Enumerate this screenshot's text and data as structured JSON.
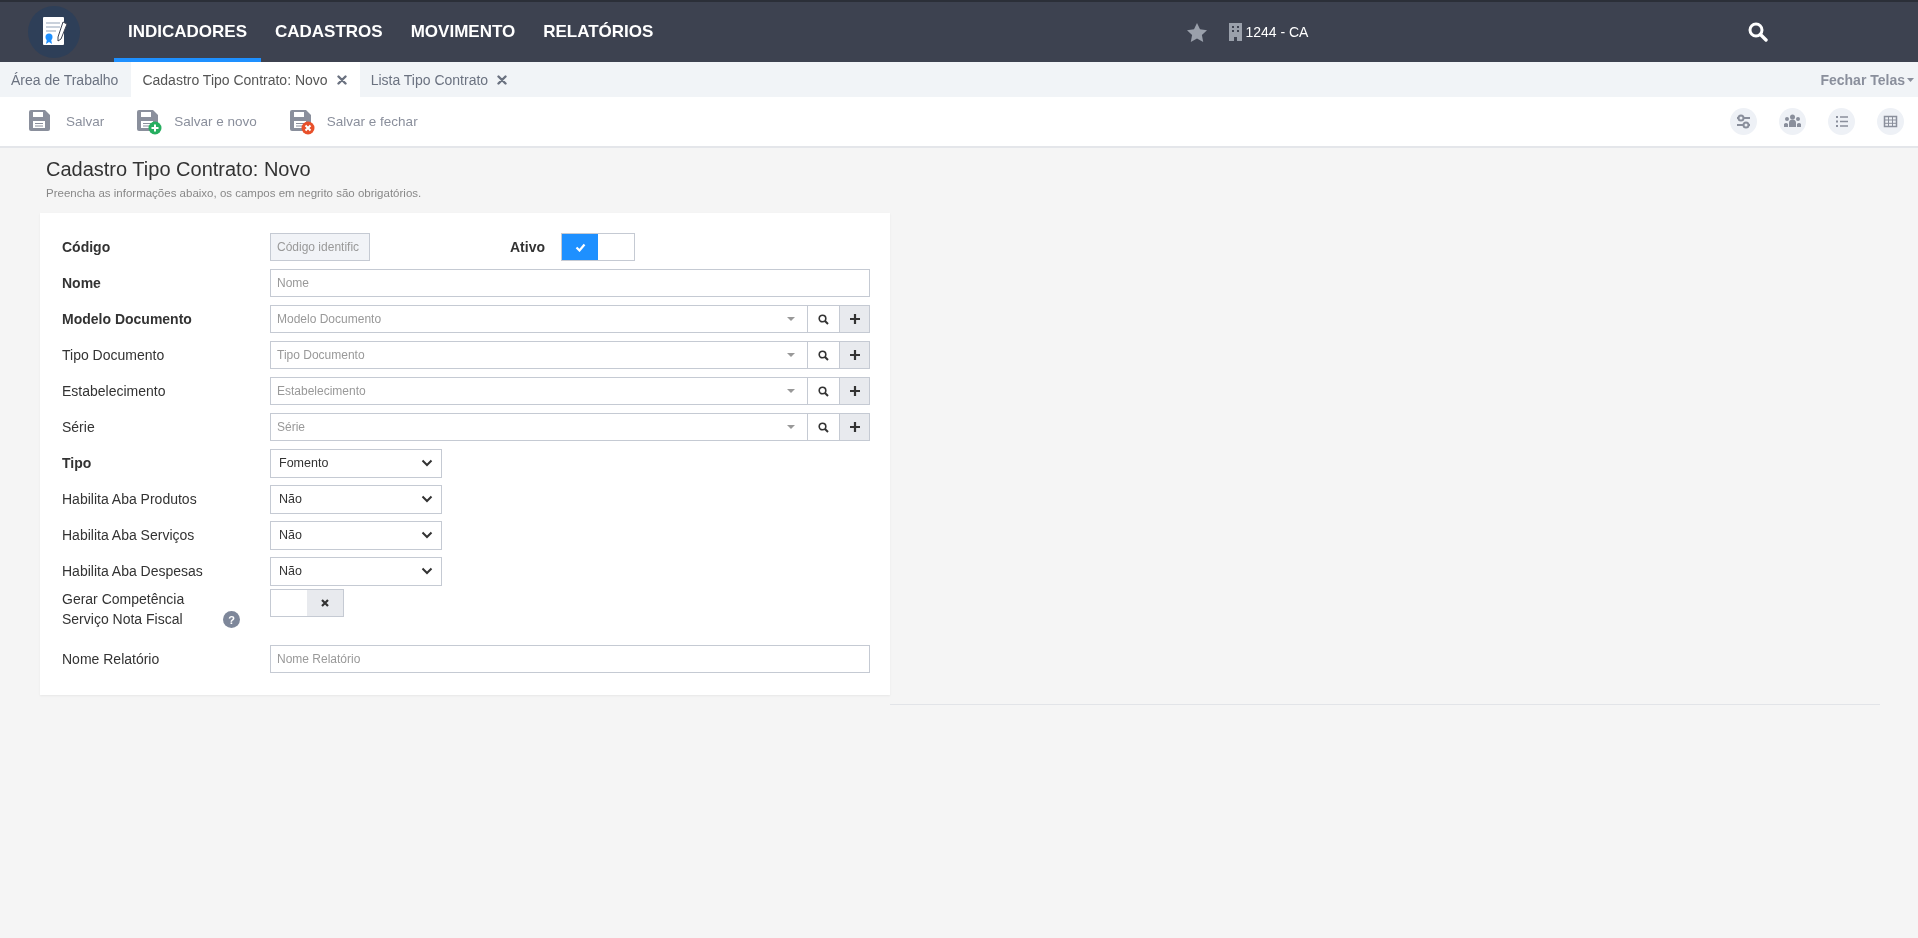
{
  "nav": {
    "items": [
      {
        "label": "INDICADORES",
        "selected": true
      },
      {
        "label": "CADASTROS",
        "selected": false
      },
      {
        "label": "MOVIMENTO",
        "selected": false
      },
      {
        "label": "RELATÓRIOS",
        "selected": false
      }
    ],
    "company": "1244 - CA"
  },
  "tabs": [
    {
      "label": "Área de Trabalho",
      "selected": false,
      "closable": false
    },
    {
      "label": "Cadastro Tipo Contrato: Novo",
      "selected": true,
      "closable": true
    },
    {
      "label": "Lista Tipo Contrato",
      "selected": false,
      "closable": true
    }
  ],
  "close_all": "Fechar Telas",
  "toolbar": [
    {
      "label": "Salvar",
      "kind": "save"
    },
    {
      "label": "Salvar e novo",
      "kind": "save-new"
    },
    {
      "label": "Salvar e fechar",
      "kind": "save-close"
    }
  ],
  "page": {
    "title": "Cadastro Tipo Contrato: Novo",
    "subtitle": "Preencha as informações abaixo, os campos em negrito são obrigatórios."
  },
  "fields": [
    {
      "kind": "code",
      "label": "Código",
      "required": true,
      "placeholder": "Código identific",
      "toggle": {
        "label": "Ativo",
        "required": true,
        "on": true
      }
    },
    {
      "kind": "text",
      "label": "Nome",
      "required": true,
      "placeholder": "Nome"
    },
    {
      "kind": "lookup",
      "label": "Modelo Documento",
      "required": true,
      "placeholder": "Modelo Documento"
    },
    {
      "kind": "lookup",
      "label": "Tipo Documento",
      "required": false,
      "placeholder": "Tipo Documento"
    },
    {
      "kind": "lookup",
      "label": "Estabelecimento",
      "required": false,
      "placeholder": "Estabelecimento"
    },
    {
      "kind": "lookup",
      "label": "Série",
      "required": false,
      "placeholder": "Série"
    },
    {
      "kind": "select",
      "label": "Tipo",
      "required": true,
      "value": "Fomento"
    },
    {
      "kind": "select",
      "label": "Habilita Aba Produtos",
      "required": false,
      "value": "Não"
    },
    {
      "kind": "select",
      "label": "Habilita Aba Serviços",
      "required": false,
      "value": "Não"
    },
    {
      "kind": "select",
      "label": "Habilita Aba Despesas",
      "required": false,
      "value": "Não"
    },
    {
      "kind": "toggle",
      "label": "Gerar Competência Serviço Nota Fiscal",
      "required": false,
      "on": false,
      "help": "?"
    },
    {
      "kind": "text",
      "label": "Nome Relatório",
      "required": false,
      "placeholder": "Nome Relatório"
    }
  ]
}
